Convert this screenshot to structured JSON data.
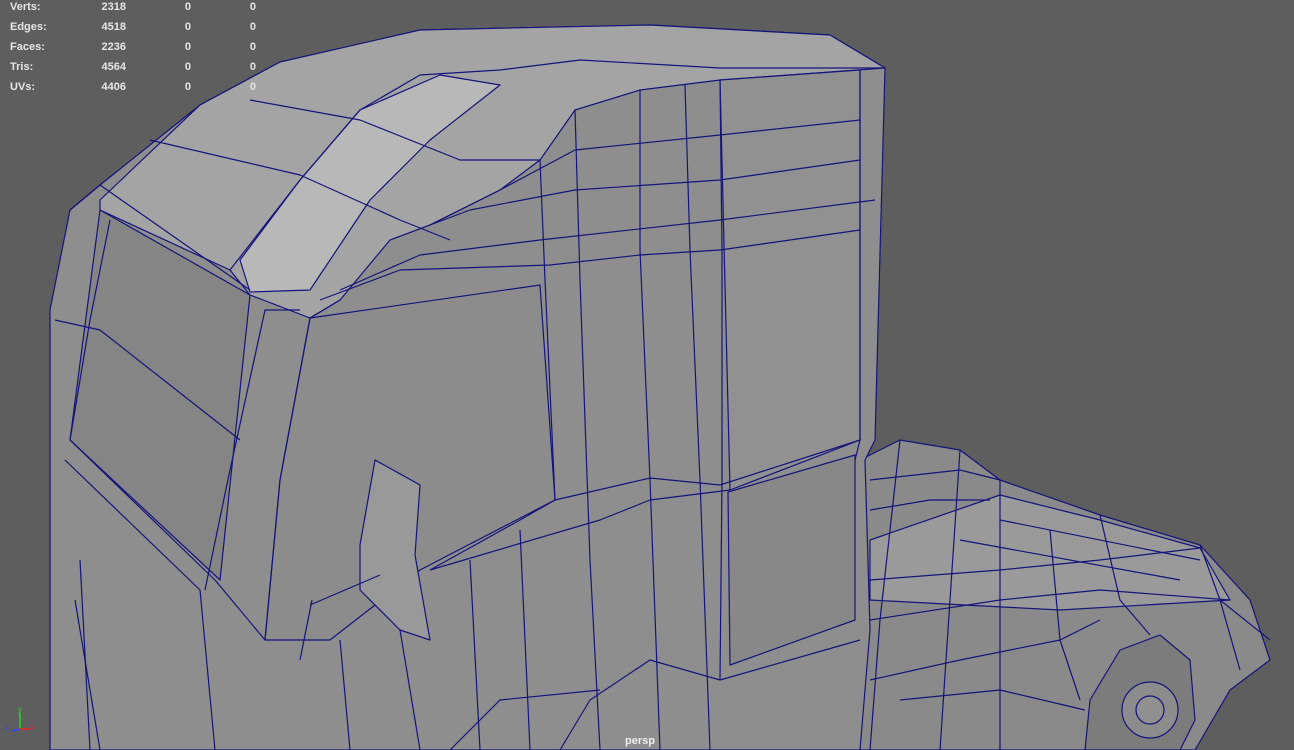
{
  "hud": {
    "rows": [
      {
        "label": "Verts:",
        "total": "2318",
        "selected": "0",
        "other": "0"
      },
      {
        "label": "Edges:",
        "total": "4518",
        "selected": "0",
        "other": "0"
      },
      {
        "label": "Faces:",
        "total": "2236",
        "selected": "0",
        "other": "0"
      },
      {
        "label": "Tris:",
        "total": "4564",
        "selected": "0",
        "other": "0"
      },
      {
        "label": "UVs:",
        "total": "4406",
        "selected": "0",
        "other": "0"
      }
    ]
  },
  "camera": {
    "name": "persp"
  },
  "axis": {
    "x": "x",
    "y": "y",
    "z": "z"
  },
  "colors": {
    "background": "#5e5e5e",
    "mesh": "#8f8f8f",
    "wire": "#14147a"
  }
}
